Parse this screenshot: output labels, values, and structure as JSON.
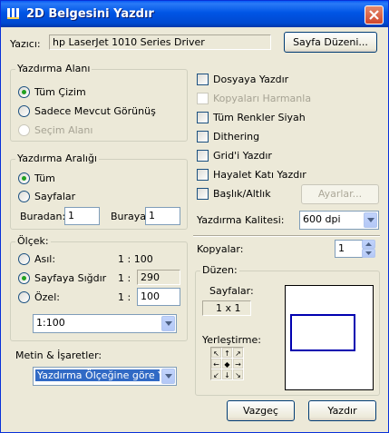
{
  "window": {
    "title": "2D Belgesini Yazdır",
    "close_glyph": "✕",
    "icon": "app-icon"
  },
  "printer": {
    "label": "Yazıcı:",
    "value": "hp LaserJet 1010 Series Driver",
    "page_setup_button": "Sayfa Düzeni..."
  },
  "print_area": {
    "legend": "Yazdırma Alanı",
    "options": [
      "Tüm Çizim",
      "Sadece Mevcut Görünüş",
      "Seçim Alanı"
    ],
    "selected": "Tüm Çizim",
    "disabled": [
      "Seçim Alanı"
    ]
  },
  "print_range": {
    "legend": "Yazdırma Aralığı",
    "options": [
      "Tüm",
      "Sayfalar"
    ],
    "selected": "Tüm",
    "from_label": "Buradan:",
    "from_value": "1",
    "to_label": "Buraya:",
    "to_value": "1"
  },
  "scale": {
    "legend": "Ölçek:",
    "rows": [
      {
        "label": "Asıl:",
        "prefix": "1 : 100",
        "value": ""
      },
      {
        "label": "Sayfaya Sığdır",
        "prefix": "1 :",
        "value": "290"
      },
      {
        "label": "Özel:",
        "prefix": "1 :",
        "value": "100"
      }
    ],
    "selected": "Sayfaya Sığdır",
    "dropdown_value": "1:100"
  },
  "text_markers": {
    "label": "Metin & İşaretler:",
    "dropdown_value": "Yazdırma Ölçeğine göre Yen"
  },
  "options": {
    "checkboxes": [
      {
        "label": "Dosyaya Yazdır",
        "checked": false,
        "disabled": false
      },
      {
        "label": "Kopyaları Harmanla",
        "checked": false,
        "disabled": true
      },
      {
        "label": "Tüm Renkler Siyah",
        "checked": false,
        "disabled": false
      },
      {
        "label": "Dithering",
        "checked": false,
        "disabled": false
      },
      {
        "label": "Grid'i Yazdır",
        "checked": false,
        "disabled": false
      },
      {
        "label": "Hayalet Katı Yazdır",
        "checked": false,
        "disabled": false
      },
      {
        "label": "Başlık/Altlık",
        "checked": false,
        "disabled": false
      }
    ],
    "settings_button": "Ayarlar...",
    "quality_label": "Yazdırma Kalitesi:",
    "quality_value": "600 dpi"
  },
  "copies": {
    "label": "Kopyalar:",
    "value": "1"
  },
  "layout": {
    "legend": "Düzen:",
    "pages_label": "Sayfalar:",
    "pages_value": "1 x 1",
    "placement_label": "Yerleştirme:"
  },
  "footer": {
    "cancel": "Vazgeç",
    "print": "Yazdır"
  }
}
